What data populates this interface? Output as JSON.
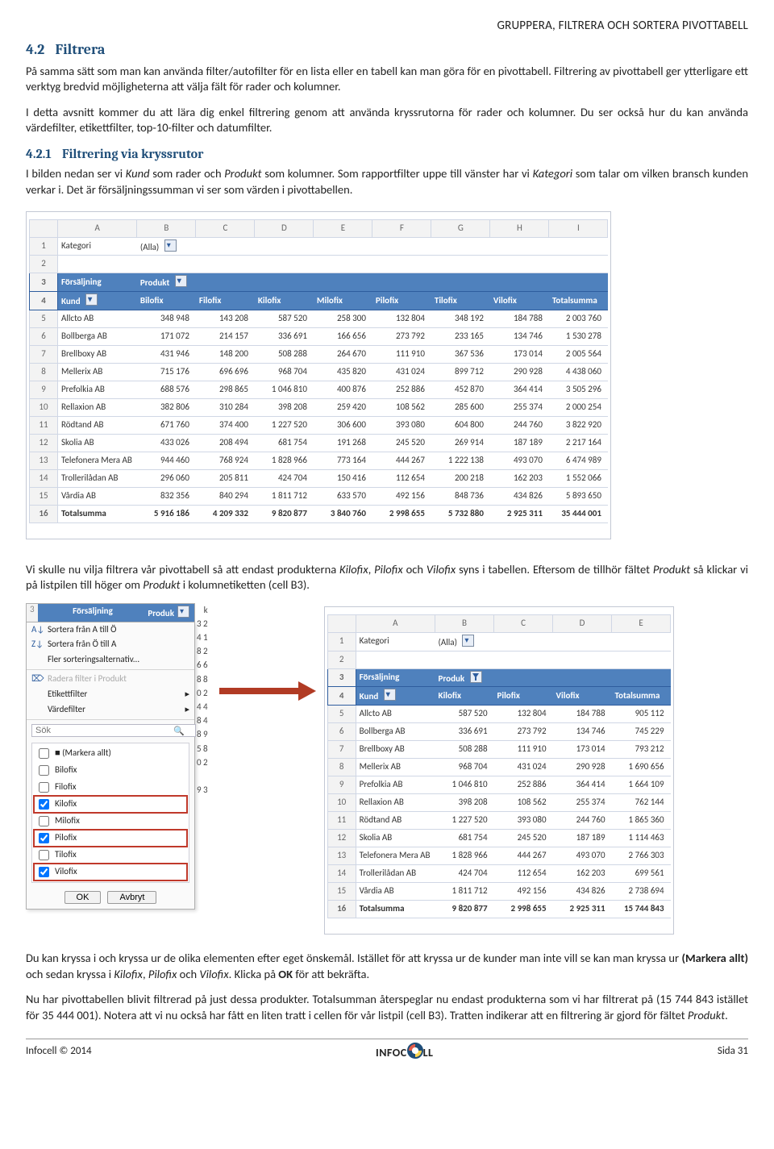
{
  "page_header_right": "GRUPPERA, FILTRERA OCH SORTERA PIVOTTABELL",
  "section": {
    "num": "4.2",
    "title": "Filtrera"
  },
  "para_intro_1": "På samma sätt som man kan använda filter/autofilter för en lista eller en tabell kan man göra för en pivottabell. Filtrering av pivottabell ger ytterligare ett verktyg bredvid möjligheterna att välja fält för rader och kolumner.",
  "para_intro_2": "I detta avsnitt kommer du att lära dig enkel filtrering genom att använda kryssrutorna för rader och kolumner. Du ser också hur du kan använda värdefilter, etikettfilter, top-10-filter och datumfilter.",
  "subsection": {
    "num": "4.2.1",
    "title": "Filtrering via kryssrutor"
  },
  "para_sub_1a": "I bilden nedan ser vi ",
  "kund_word": "Kund",
  "para_sub_1b": " som rader och ",
  "produkt_word": "Produkt",
  "para_sub_1c": " som kolumner. Som rapportfilter uppe till vänster har vi ",
  "kategori_word": "Kategori",
  "para_sub_1d": " som talar om vilken bransch kunden verkar i. Det är försäljningssumman vi ser som värden i pivottabellen.",
  "pivot1": {
    "cols": [
      "A",
      "B",
      "C",
      "D",
      "E",
      "F",
      "G",
      "H",
      "I"
    ],
    "row1": {
      "label": "Kategori",
      "val": "(Alla)"
    },
    "header_top": "Försäljning",
    "header_prod": "Produkt",
    "header_kund": "Kund",
    "products": [
      "Bilofix",
      "Filofix",
      "Kilofix",
      "Milofix",
      "Pilofix",
      "Tilofix",
      "Vilofix",
      "Totalsumma"
    ],
    "rows": [
      {
        "n": "5",
        "k": "Allcto AB",
        "v": [
          "348 948",
          "143 208",
          "587 520",
          "258 300",
          "132 804",
          "348 192",
          "184 788",
          "2 003 760"
        ]
      },
      {
        "n": "6",
        "k": "Bollberga AB",
        "v": [
          "171 072",
          "214 157",
          "336 691",
          "166 656",
          "273 792",
          "233 165",
          "134 746",
          "1 530 278"
        ]
      },
      {
        "n": "7",
        "k": "Brellboxy AB",
        "v": [
          "431 946",
          "148 200",
          "508 288",
          "264 670",
          "111 910",
          "367 536",
          "173 014",
          "2 005 564"
        ]
      },
      {
        "n": "8",
        "k": "Mellerix AB",
        "v": [
          "715 176",
          "696 696",
          "968 704",
          "435 820",
          "431 024",
          "899 712",
          "290 928",
          "4 438 060"
        ]
      },
      {
        "n": "9",
        "k": "Prefolkia AB",
        "v": [
          "688 576",
          "298 865",
          "1 046 810",
          "400 876",
          "252 886",
          "452 870",
          "364 414",
          "3 505 296"
        ]
      },
      {
        "n": "10",
        "k": "Rellaxion AB",
        "v": [
          "382 806",
          "310 284",
          "398 208",
          "259 420",
          "108 562",
          "285 600",
          "255 374",
          "2 000 254"
        ]
      },
      {
        "n": "11",
        "k": "Rödtand AB",
        "v": [
          "671 760",
          "374 400",
          "1 227 520",
          "306 600",
          "393 080",
          "604 800",
          "244 760",
          "3 822 920"
        ]
      },
      {
        "n": "12",
        "k": "Skolia AB",
        "v": [
          "433 026",
          "208 494",
          "681 754",
          "191 268",
          "245 520",
          "269 914",
          "187 189",
          "2 217 164"
        ]
      },
      {
        "n": "13",
        "k": "Telefonera Mera AB",
        "v": [
          "944 460",
          "768 924",
          "1 828 966",
          "773 164",
          "444 267",
          "1 222 138",
          "493 070",
          "6 474 989"
        ]
      },
      {
        "n": "14",
        "k": "Trollerilådan AB",
        "v": [
          "296 060",
          "205 811",
          "424 704",
          "150 416",
          "112 654",
          "200 218",
          "162 203",
          "1 552 066"
        ]
      },
      {
        "n": "15",
        "k": "Vårdia AB",
        "v": [
          "832 356",
          "840 294",
          "1 811 712",
          "633 570",
          "492 156",
          "848 736",
          "434 826",
          "5 893 650"
        ]
      }
    ],
    "total": {
      "n": "16",
      "k": "Totalsumma",
      "v": [
        "5 916 186",
        "4 209 332",
        "9 820 877",
        "3 840 760",
        "2 998 655",
        "5 732 880",
        "2 925 311",
        "35 444 001"
      ]
    }
  },
  "para_mid_a": "Vi skulle nu vilja filtrera vår pivottabell så att endast produkterna ",
  "kpv": {
    "k": "Kilofix",
    "p": "Pilofix",
    "v": "Vilofix"
  },
  "para_mid_b": " syns i tabellen. Eftersom de tillhör fältet ",
  "para_mid_c": " så klickar vi på listpilen till höger om ",
  "cellref": "(cell B3)",
  "para_mid_d": " i kolumnetiketten ",
  "filter_menu": {
    "header_l": "Försäljning",
    "header_r": "Produk",
    "sort_az": "Sortera från A till Ö",
    "sort_za": "Sortera från Ö till A",
    "more_sort": "Fler sorteringsalternativ...",
    "clear": "Radera filter i Produkt",
    "label_filter": "Etikettfilter",
    "value_filter": "Värdefilter",
    "search_ph": "Sök",
    "items": [
      "(Markera allt)",
      "Bilofix",
      "Filofix",
      "Kilofix",
      "Milofix",
      "Pilofix",
      "Tilofix",
      "Vilofix"
    ],
    "checked": [
      "Kilofix",
      "Pilofix",
      "Vilofix"
    ],
    "ok": "OK",
    "cancel": "Avbryt",
    "side_nums": [
      "k",
      "3 2",
      "4 1",
      "8 2",
      "6 6",
      "8 8",
      "0 2",
      "4 4",
      "8 4",
      "8 9",
      "5 8",
      "0 2",
      "",
      "9 3"
    ]
  },
  "pivot2": {
    "cols": [
      "A",
      "B",
      "C",
      "D",
      "E"
    ],
    "row1": {
      "label": "Kategori",
      "val": "(Alla)"
    },
    "header_top": "Försäljning",
    "header_prod": "Produk",
    "header_kund": "Kund",
    "products": [
      "Kilofix",
      "Pilofix",
      "Vilofix",
      "Totalsumma"
    ],
    "rows": [
      {
        "n": "5",
        "k": "Allcto AB",
        "v": [
          "587 520",
          "132 804",
          "184 788",
          "905 112"
        ]
      },
      {
        "n": "6",
        "k": "Bollberga AB",
        "v": [
          "336 691",
          "273 792",
          "134 746",
          "745 229"
        ]
      },
      {
        "n": "7",
        "k": "Brellboxy AB",
        "v": [
          "508 288",
          "111 910",
          "173 014",
          "793 212"
        ]
      },
      {
        "n": "8",
        "k": "Mellerix AB",
        "v": [
          "968 704",
          "431 024",
          "290 928",
          "1 690 656"
        ]
      },
      {
        "n": "9",
        "k": "Prefolkia AB",
        "v": [
          "1 046 810",
          "252 886",
          "364 414",
          "1 664 109"
        ]
      },
      {
        "n": "10",
        "k": "Rellaxion AB",
        "v": [
          "398 208",
          "108 562",
          "255 374",
          "762 144"
        ]
      },
      {
        "n": "11",
        "k": "Rödtand AB",
        "v": [
          "1 227 520",
          "393 080",
          "244 760",
          "1 865 360"
        ]
      },
      {
        "n": "12",
        "k": "Skolia AB",
        "v": [
          "681 754",
          "245 520",
          "187 189",
          "1 114 463"
        ]
      },
      {
        "n": "13",
        "k": "Telefonera Mera AB",
        "v": [
          "1 828 966",
          "444 267",
          "493 070",
          "2 766 303"
        ]
      },
      {
        "n": "14",
        "k": "Trollerilådan AB",
        "v": [
          "424 704",
          "112 654",
          "162 203",
          "699 561"
        ]
      },
      {
        "n": "15",
        "k": "Vårdia AB",
        "v": [
          "1 811 712",
          "492 156",
          "434 826",
          "2 738 694"
        ]
      }
    ],
    "total": {
      "n": "16",
      "k": "Totalsumma",
      "v": [
        "9 820 877",
        "2 998 655",
        "2 925 311",
        "15 744 843"
      ]
    }
  },
  "para_end_1a": "Du kan kryssa i och kryssa ur de olika elementen efter eget önskemål. Istället för att kryssa ur de kunder man inte vill se kan man kryssa ur ",
  "markera_allt": "(Markera allt)",
  "para_end_1b": " och sedan kryssa i ",
  "para_end_1c": ". Klicka på ",
  "ok_bold": "OK",
  "para_end_1d": " för att bekräfta.",
  "para_end_2": "Nu har pivottabellen blivit filtrerad på just dessa produkter. Totalsumman återspeglar nu endast produkterna som vi har filtrerat på (15 744 843 istället för 35 444 001). Notera att vi nu också har fått en liten tratt i cellen för vår listpil (cell B3). Tratten indikerar att en filtrering är gjord för fältet ",
  "footer": {
    "left": "Infocell © 2014",
    "right": "Sida 31",
    "logo": "INFOC  LL"
  },
  "chart_data": [
    {
      "type": "table",
      "title": "Pivottabell – Försäljning (alla produkter)",
      "row_field": "Kund",
      "column_field": "Produkt",
      "columns": [
        "Bilofix",
        "Filofix",
        "Kilofix",
        "Milofix",
        "Pilofix",
        "Tilofix",
        "Vilofix",
        "Totalsumma"
      ],
      "rows": [
        [
          "Allcto AB",
          348948,
          143208,
          587520,
          258300,
          132804,
          348192,
          184788,
          2003760
        ],
        [
          "Bollberga AB",
          171072,
          214157,
          336691,
          166656,
          273792,
          233165,
          134746,
          1530278
        ],
        [
          "Brellboxy AB",
          431946,
          148200,
          508288,
          264670,
          111910,
          367536,
          173014,
          2005564
        ],
        [
          "Mellerix AB",
          715176,
          696696,
          968704,
          435820,
          431024,
          899712,
          290928,
          4438060
        ],
        [
          "Prefolkia AB",
          688576,
          298865,
          1046810,
          400876,
          252886,
          452870,
          364414,
          3505296
        ],
        [
          "Rellaxion AB",
          382806,
          310284,
          398208,
          259420,
          108562,
          285600,
          255374,
          2000254
        ],
        [
          "Rödtand AB",
          671760,
          374400,
          1227520,
          306600,
          393080,
          604800,
          244760,
          3822920
        ],
        [
          "Skolia AB",
          433026,
          208494,
          681754,
          191268,
          245520,
          269914,
          187189,
          2217164
        ],
        [
          "Telefonera Mera AB",
          944460,
          768924,
          1828966,
          773164,
          444267,
          1222138,
          493070,
          6474989
        ],
        [
          "Trollerilådan AB",
          296060,
          205811,
          424704,
          150416,
          112654,
          200218,
          162203,
          1552066
        ],
        [
          "Vårdia AB",
          832356,
          840294,
          1811712,
          633570,
          492156,
          848736,
          434826,
          5893650
        ],
        [
          "Totalsumma",
          5916186,
          4209332,
          9820877,
          3840760,
          2998655,
          5732880,
          2925311,
          35444001
        ]
      ]
    },
    {
      "type": "table",
      "title": "Pivottabell – Försäljning (filtrerad: Kilofix, Pilofix, Vilofix)",
      "row_field": "Kund",
      "column_field": "Produkt",
      "columns": [
        "Kilofix",
        "Pilofix",
        "Vilofix",
        "Totalsumma"
      ],
      "rows": [
        [
          "Allcto AB",
          587520,
          132804,
          184788,
          905112
        ],
        [
          "Bollberga AB",
          336691,
          273792,
          134746,
          745229
        ],
        [
          "Brellboxy AB",
          508288,
          111910,
          173014,
          793212
        ],
        [
          "Mellerix AB",
          968704,
          431024,
          290928,
          1690656
        ],
        [
          "Prefolkia AB",
          1046810,
          252886,
          364414,
          1664109
        ],
        [
          "Rellaxion AB",
          398208,
          108562,
          255374,
          762144
        ],
        [
          "Rödtand AB",
          1227520,
          393080,
          244760,
          1865360
        ],
        [
          "Skolia AB",
          681754,
          245520,
          187189,
          1114463
        ],
        [
          "Telefonera Mera AB",
          1828966,
          444267,
          493070,
          2766303
        ],
        [
          "Trollerilådan AB",
          424704,
          112654,
          162203,
          699561
        ],
        [
          "Vårdia AB",
          1811712,
          492156,
          434826,
          2738694
        ],
        [
          "Totalsumma",
          9820877,
          2998655,
          2925311,
          15744843
        ]
      ]
    }
  ]
}
